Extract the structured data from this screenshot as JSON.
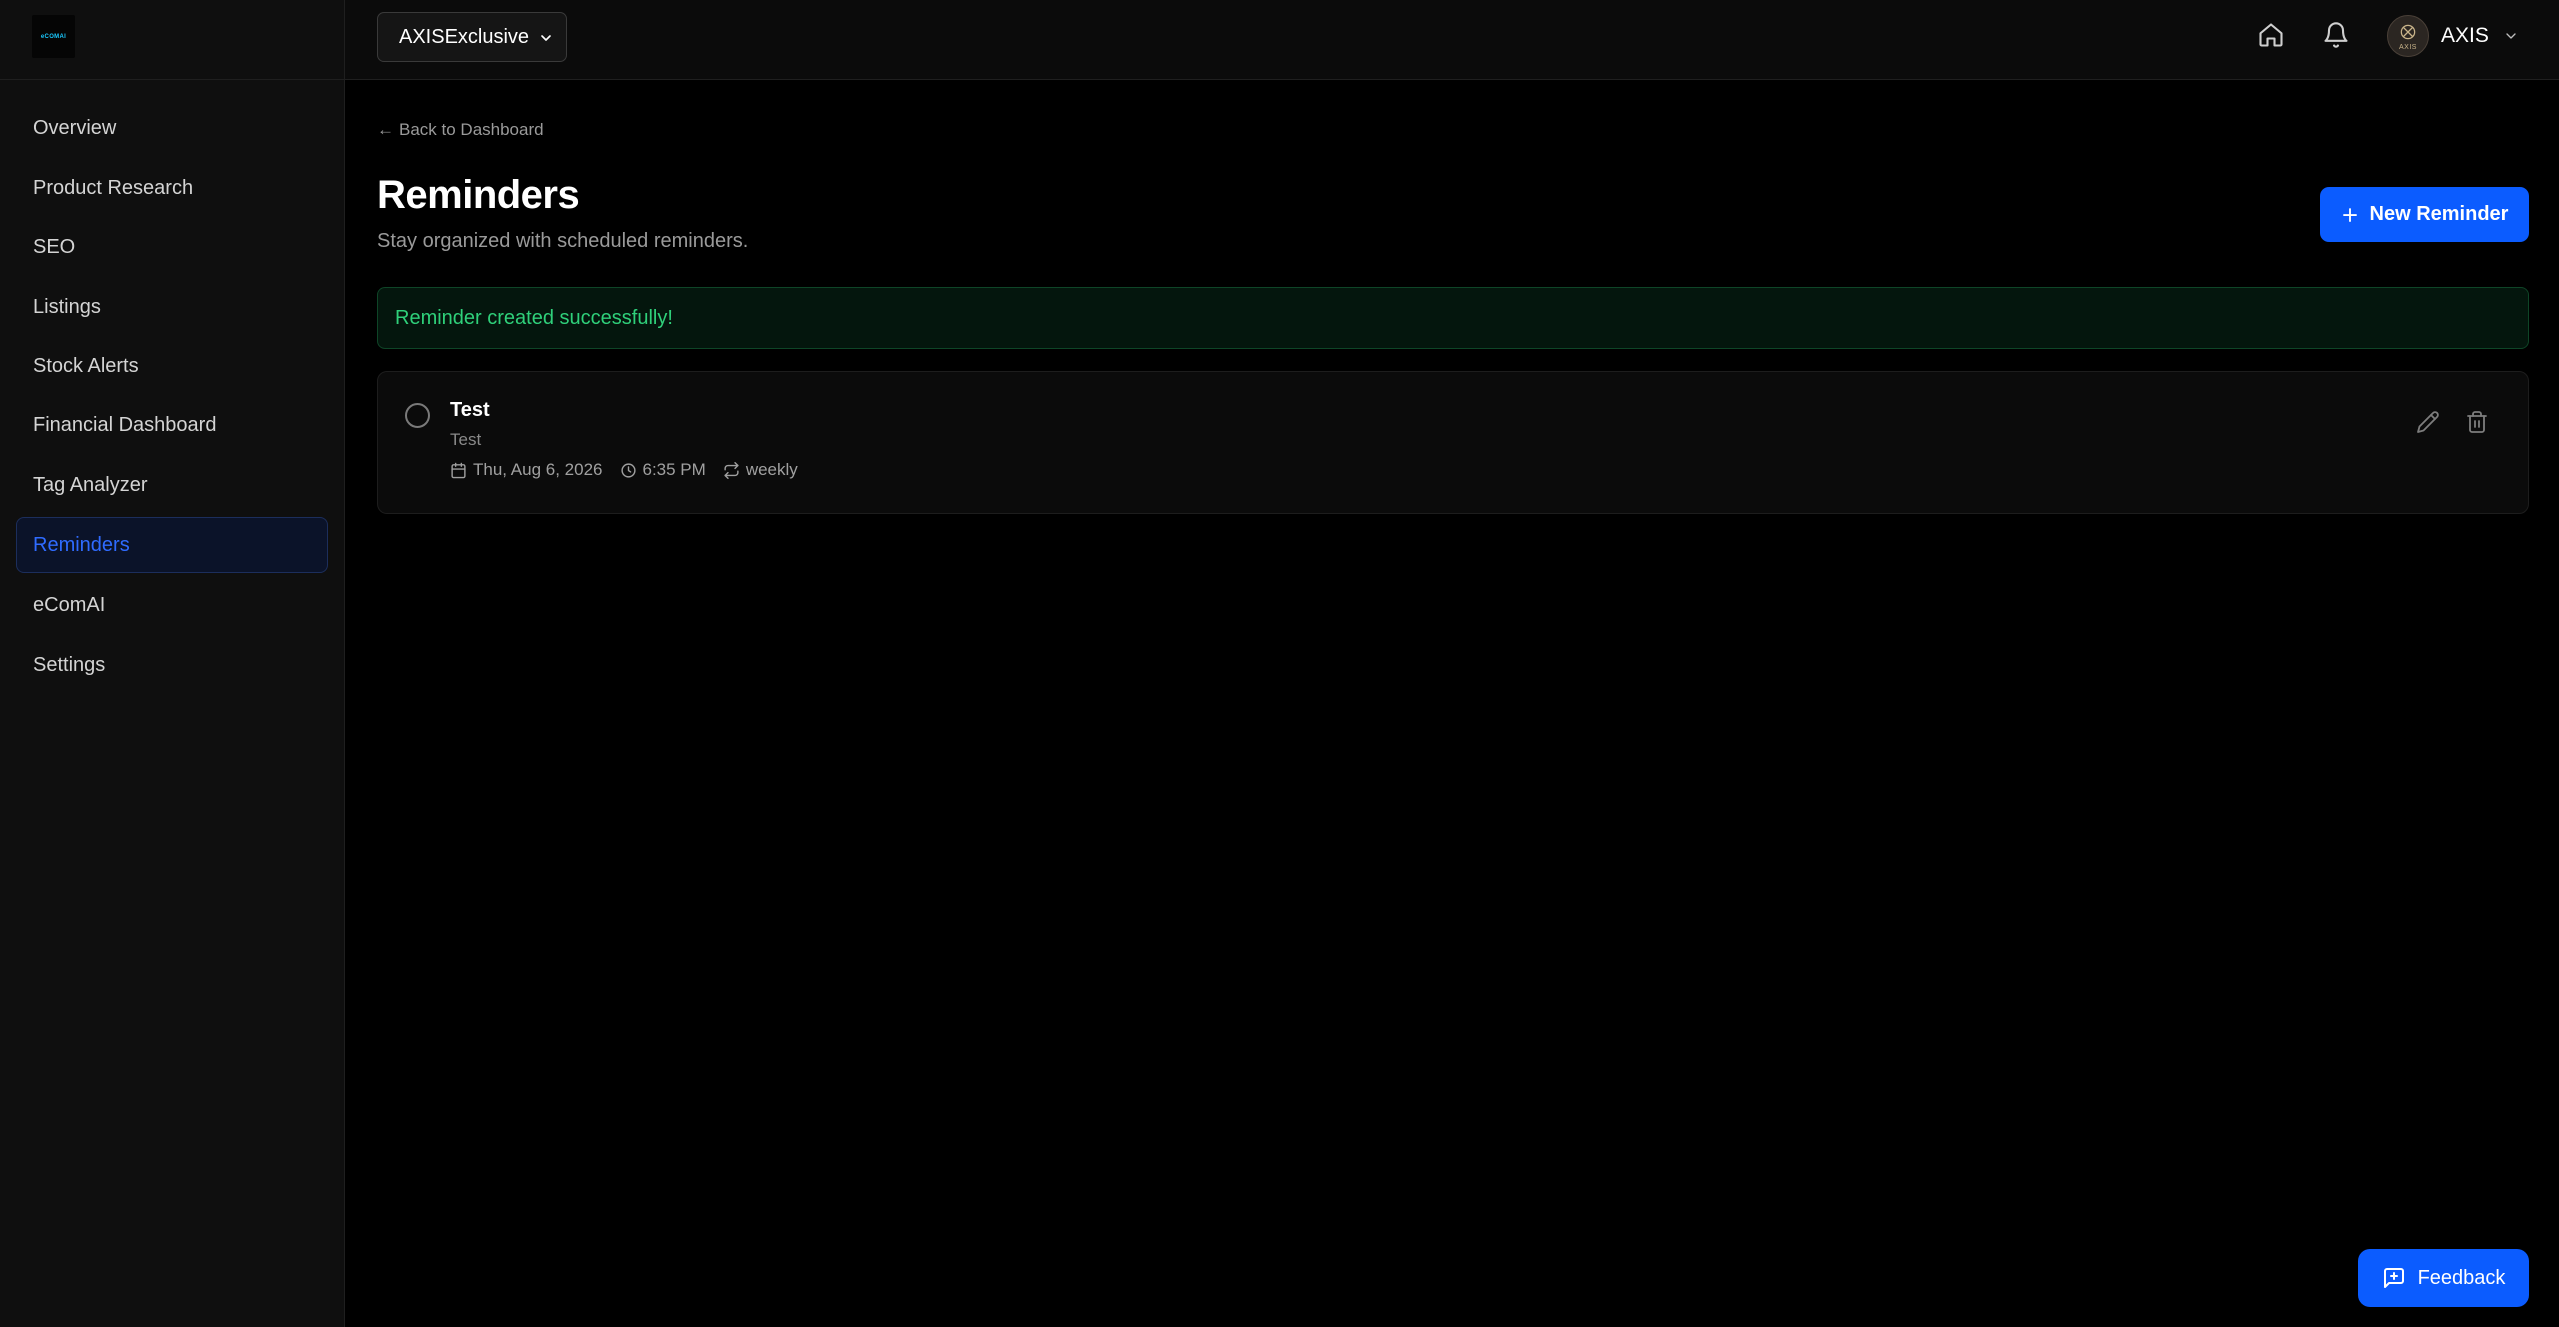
{
  "brand": {
    "logo_text": "eCOMAI"
  },
  "sidebar": {
    "items": [
      {
        "label": "Overview",
        "active": false
      },
      {
        "label": "Product Research",
        "active": false
      },
      {
        "label": "SEO",
        "active": false
      },
      {
        "label": "Listings",
        "active": false
      },
      {
        "label": "Stock Alerts",
        "active": false
      },
      {
        "label": "Financial Dashboard",
        "active": false
      },
      {
        "label": "Tag Analyzer",
        "active": false
      },
      {
        "label": "Reminders",
        "active": true
      },
      {
        "label": "eComAI",
        "active": false
      },
      {
        "label": "Settings",
        "active": false
      }
    ]
  },
  "header": {
    "store_selector": {
      "value": "AXISExclusive"
    },
    "icons": [
      "home-icon",
      "bell-icon"
    ],
    "user": {
      "name": "AXIS",
      "avatar_text": "AXIS"
    }
  },
  "page": {
    "back_link": "Back to Dashboard",
    "back_arrow": "←",
    "title": "Reminders",
    "subtitle": "Stay organized with scheduled reminders.",
    "new_button_label": "New Reminder",
    "success_message": "Reminder created successfully!"
  },
  "reminders": [
    {
      "title": "Test",
      "description": "Test",
      "date": "Thu, Aug 6, 2026",
      "time": "6:35 PM",
      "recurrence": "weekly",
      "completed": false
    }
  ],
  "feedback": {
    "label": "Feedback"
  },
  "colors": {
    "accent": "#0b5cff",
    "active_nav_text": "#2f6bff",
    "success_text": "#2fd07a",
    "background": "#000000",
    "sidebar_bg": "#0f0f0f"
  }
}
